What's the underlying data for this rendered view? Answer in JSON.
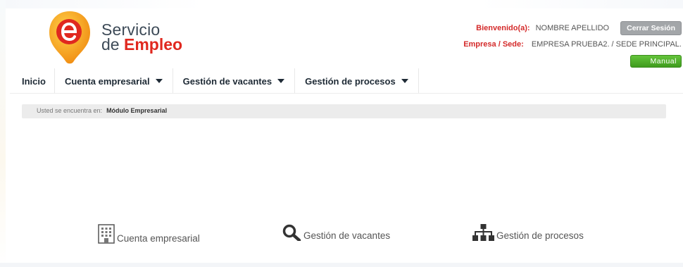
{
  "brand": {
    "line1": "Servicio",
    "line2_prefix": "de ",
    "line2_highlight": "Empleo",
    "logo_icon": "servicio-empleo-logo"
  },
  "user": {
    "welcome_label": "Bienvenido(a):",
    "name": "NOMBRE APELLIDO",
    "logout_label": "Cerrar Sesión",
    "company_label": "Empresa / Sede:",
    "company_value": "EMPRESA PRUEBA2. / SEDE PRINCIPAL.",
    "manual_label": "Manual"
  },
  "nav": {
    "items": [
      {
        "label": "Inicio",
        "dropdown": false
      },
      {
        "label": "Cuenta empresarial",
        "dropdown": true
      },
      {
        "label": "Gestión de vacantes",
        "dropdown": true
      },
      {
        "label": "Gestión de procesos",
        "dropdown": true
      }
    ]
  },
  "breadcrumb": {
    "prefix": "Usted se encuentra en:",
    "current": "Módulo Empresarial"
  },
  "modules": [
    {
      "label": "Cuenta empresarial",
      "icon": "building-icon"
    },
    {
      "label": "Gestión de vacantes",
      "icon": "search-icon"
    },
    {
      "label": "Gestión de procesos",
      "icon": "org-chart-icon"
    }
  ],
  "colors": {
    "brand_red": "#e0281f",
    "label_red": "#d42a2a",
    "manual_green": "#4caf28",
    "logout_gray": "#a3a6a9",
    "logo_orange": "#f5a623"
  }
}
